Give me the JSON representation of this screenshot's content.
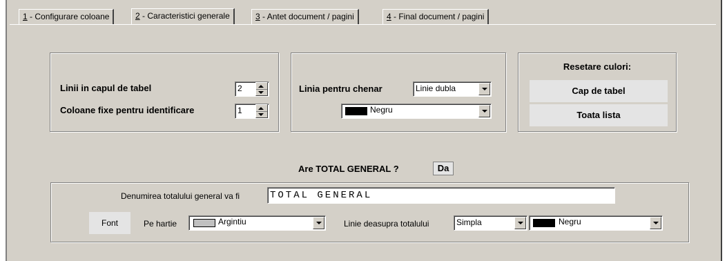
{
  "tabs": [
    {
      "num": "1",
      "label": " - Configurare coloane"
    },
    {
      "num": "2",
      "label": " - Caracteristici generale"
    },
    {
      "num": "3",
      "label": " - Antet document / pagini"
    },
    {
      "num": "4",
      "label": " - Final document / pagini"
    }
  ],
  "header_rows": {
    "label": "Linii in capul de tabel",
    "value": "2"
  },
  "fixed_columns": {
    "label": "Coloane fixe pentru identificare",
    "value": "1"
  },
  "border_line": {
    "label": "Linia pentru chenar",
    "style_value": "Linie dubla",
    "color_value": "Negru",
    "color_hex": "#000000"
  },
  "reset_colors": {
    "title": "Resetare culori:",
    "header_button": "Cap de tabel",
    "all_button": "Toata lista"
  },
  "total": {
    "question": "Are TOTAL GENERAL ?",
    "answer": "Da",
    "name_label": "Denumirea totalului general va fi",
    "name_value": "TOTAL GENERAL",
    "font_button": "Font",
    "paper_label": "Pe hartie",
    "paper_value": "Argintiu",
    "paper_hex": "#c0c0c0",
    "line_label": "Linie deasupra totalului",
    "line_style": "Simpla",
    "line_color": "Negru",
    "line_color_hex": "#000000"
  }
}
